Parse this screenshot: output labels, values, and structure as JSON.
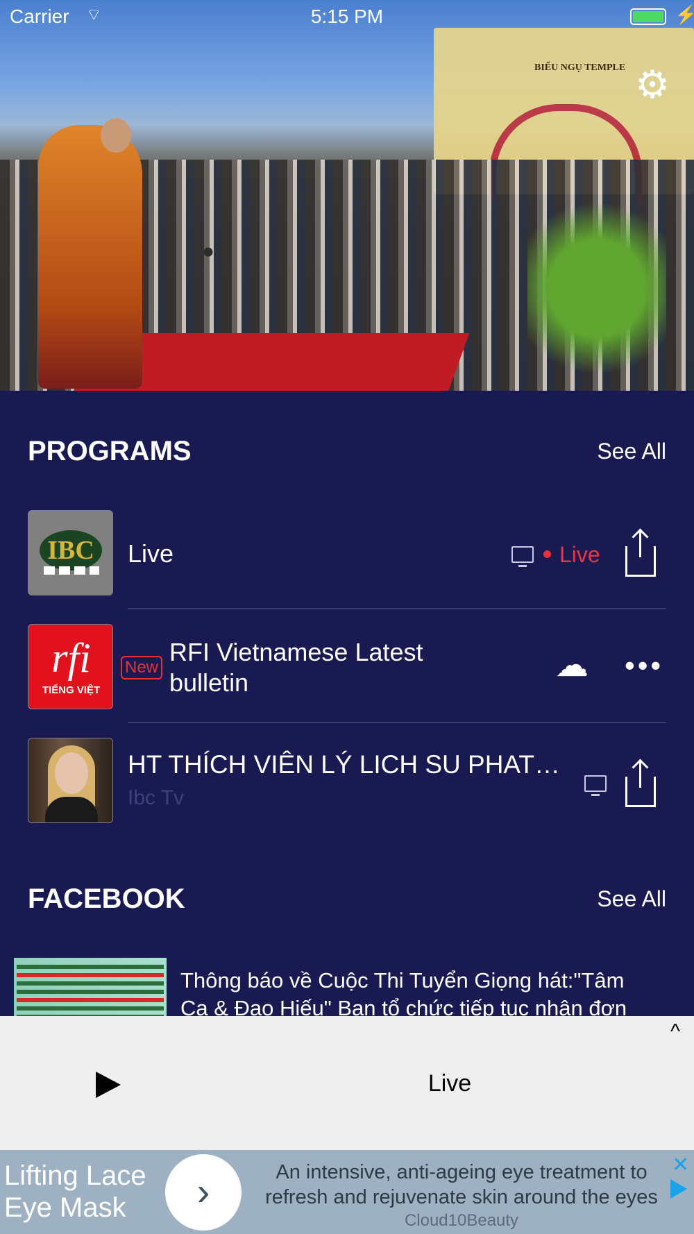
{
  "status_bar": {
    "carrier": "Carrier",
    "wifi_glyph": "⌔",
    "time": "5:15 PM",
    "bolt": "⚡"
  },
  "hero": {
    "gate_sign": "BIỂU NGỤ TEMPLE",
    "settings_icon": "gear-icon",
    "settings_glyph": "⚙"
  },
  "programs": {
    "title": "PROGRAMS",
    "see_all": "See All",
    "items": [
      {
        "title": "Live",
        "status": "Live",
        "thumb_text": "IBC"
      },
      {
        "title_line1": "RFI Vietnamese Latest",
        "title_line2": "bulletin",
        "badge": "New",
        "thumb_text": "rfi",
        "thumb_sub": "TIẾNG VIỆT"
      },
      {
        "title": "HT THÍCH VIÊN LÝ LICH SU PHAT…",
        "subtitle": "Ibc Tv"
      }
    ],
    "more_glyph": "•••",
    "download_glyph": "☁"
  },
  "facebook": {
    "title": "FACEBOOK",
    "see_all": "See All",
    "post_text_line1": "Thông báo về Cuộc Thi Tuyển Giọng hát:\"Tâm",
    "post_text_line2": "Ca & Đạo Hiếu\" Ban tổ chức tiếp tục nhận đơn"
  },
  "player": {
    "title": "Live",
    "chevron": "^"
  },
  "ad": {
    "headline": "Lifting Lace Eye Mask",
    "arrow": "›",
    "body": "An intensive, anti-ageing eye treatment to refresh and rejuvenate skin around the eyes",
    "brand": "Cloud10Beauty",
    "close": "✕"
  },
  "colors": {
    "background": "#191a52",
    "live_red": "#ee3440",
    "player_bg": "#eeeeee",
    "ad_bg": "#9eb1c2",
    "ad_accent": "#1aa3e8"
  }
}
